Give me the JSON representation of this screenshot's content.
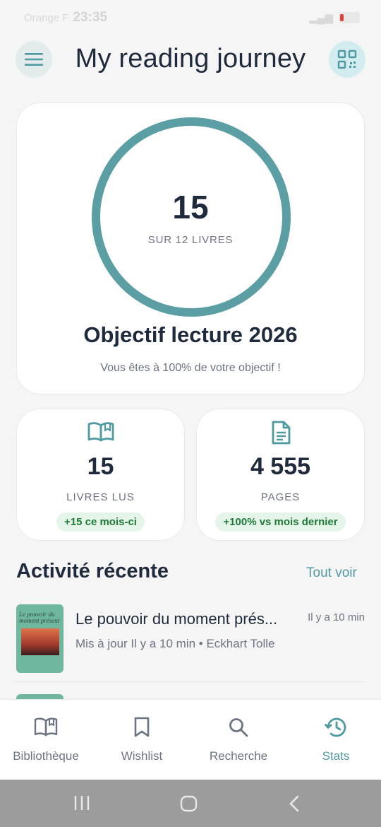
{
  "status_bar": {
    "carrier": "Orange F",
    "time": "23:35",
    "battery_icon": "battery-low-icon"
  },
  "header": {
    "title": "My reading journey",
    "menu_icon": "menu-icon",
    "qr_icon": "qr-code-icon"
  },
  "goal": {
    "progress_fraction": 1.0,
    "books_read": "15",
    "target_label": "SUR 12 LIVRES",
    "title": "Objectif lecture 2026",
    "subtitle": "Vous êtes à 100% de votre objectif !",
    "ring_color": "#5b9ea3"
  },
  "stats": [
    {
      "icon": "open-book-icon",
      "value": "15",
      "label": "LIVRES LUS",
      "badge": "+15 ce mois-ci"
    },
    {
      "icon": "document-icon",
      "value": "4 555",
      "label": "PAGES",
      "badge": "+100% vs mois dernier"
    }
  ],
  "recent": {
    "title": "Activité récente",
    "see_all": "Tout voir",
    "items": [
      {
        "title": "Le pouvoir du moment prés...",
        "time": "Il y a 10 min",
        "meta": "Mis à jour Il y a 10 min • Eckhart Tolle",
        "cover_title": "Le pouvoir du moment présent",
        "cover_author": "Eckhart Tolle"
      }
    ]
  },
  "bottom_nav": {
    "items": [
      {
        "label": "Bibliothèque",
        "icon": "library-icon"
      },
      {
        "label": "Wishlist",
        "icon": "bookmark-icon"
      },
      {
        "label": "Recherche",
        "icon": "search-icon"
      },
      {
        "label": "Stats",
        "icon": "history-icon"
      }
    ],
    "active_index": 3
  },
  "colors": {
    "accent": "#4f9aa1",
    "badge_bg": "#e6f5e9",
    "badge_text": "#1f7a38"
  }
}
